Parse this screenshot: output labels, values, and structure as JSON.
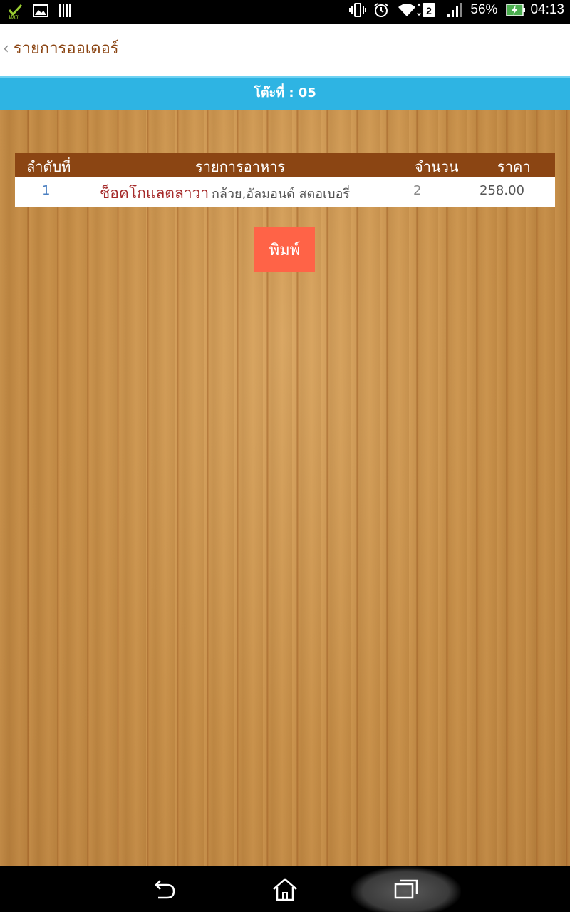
{
  "status_bar": {
    "battery_percent": "56%",
    "time": "04:13",
    "sim_badge": "2",
    "wifi_notice_label": "Wifi"
  },
  "app_bar": {
    "title": "รายการออเดอร์"
  },
  "table_bar": {
    "label": "โต๊ะที่ : 05"
  },
  "order_table": {
    "columns": [
      "ลำดับที่",
      "รายการอาหาร",
      "จำนวน",
      "ราคา"
    ],
    "rows": [
      {
        "index": "1",
        "name": "ช็อคโกแลตลาวา",
        "options": "กล้วย,อัลมอนด์ สตอเบอรี่",
        "qty": "2",
        "price": "258.00"
      }
    ]
  },
  "actions": {
    "print_label": "พิมพ์"
  },
  "colors": {
    "accent_brown": "#8B4513",
    "table_bar_blue": "#2EB4E3",
    "print_button": "#FF6347",
    "item_name_red": "#A52A2A",
    "index_blue": "#4a7fc1"
  }
}
